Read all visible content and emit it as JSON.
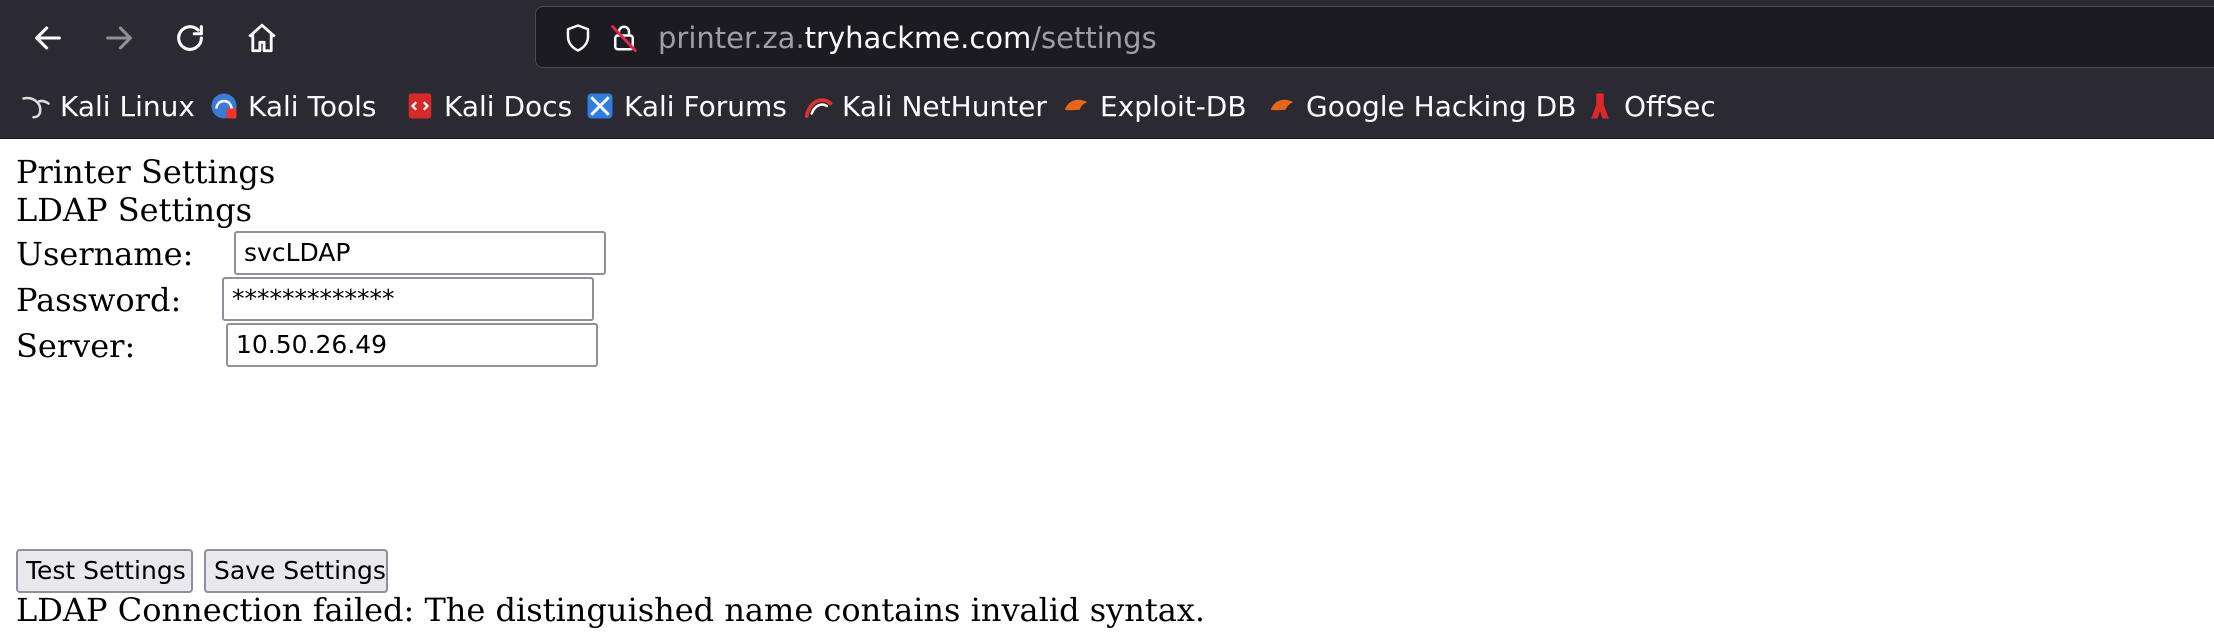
{
  "browser": {
    "url": {
      "prefix": "printer.za.",
      "host": "tryhackme.com",
      "path": "/settings"
    },
    "bookmarks": [
      {
        "label": "Kali Linux",
        "icon": "kali-dragon-icon"
      },
      {
        "label": "Kali Tools",
        "icon": "kali-tools-icon"
      },
      {
        "label": "Kali Docs",
        "icon": "kali-docs-icon"
      },
      {
        "label": "Kali Forums",
        "icon": "kali-forums-icon"
      },
      {
        "label": "Kali NetHunter",
        "icon": "kali-nethunter-icon"
      },
      {
        "label": "Exploit-DB",
        "icon": "exploit-db-icon"
      },
      {
        "label": "Google Hacking DB",
        "icon": "ghdb-icon"
      },
      {
        "label": "OffSec",
        "icon": "offsec-icon"
      }
    ]
  },
  "page": {
    "title": "Printer Settings",
    "section": "LDAP Settings",
    "username_label": "Username:",
    "username_value": "svcLDAP",
    "password_label": "Password:",
    "password_value": "*************",
    "server_label": "Server:",
    "server_value": "10.50.26.49",
    "test_button": "Test Settings",
    "save_button": "Save Settings",
    "status_message": "LDAP Connection failed: The distinguished name contains invalid syntax."
  },
  "colors": {
    "toolbar_bg": "#2b2a33",
    "urlbar_bg": "#1c1b22",
    "page_bg": "#ffffff"
  }
}
